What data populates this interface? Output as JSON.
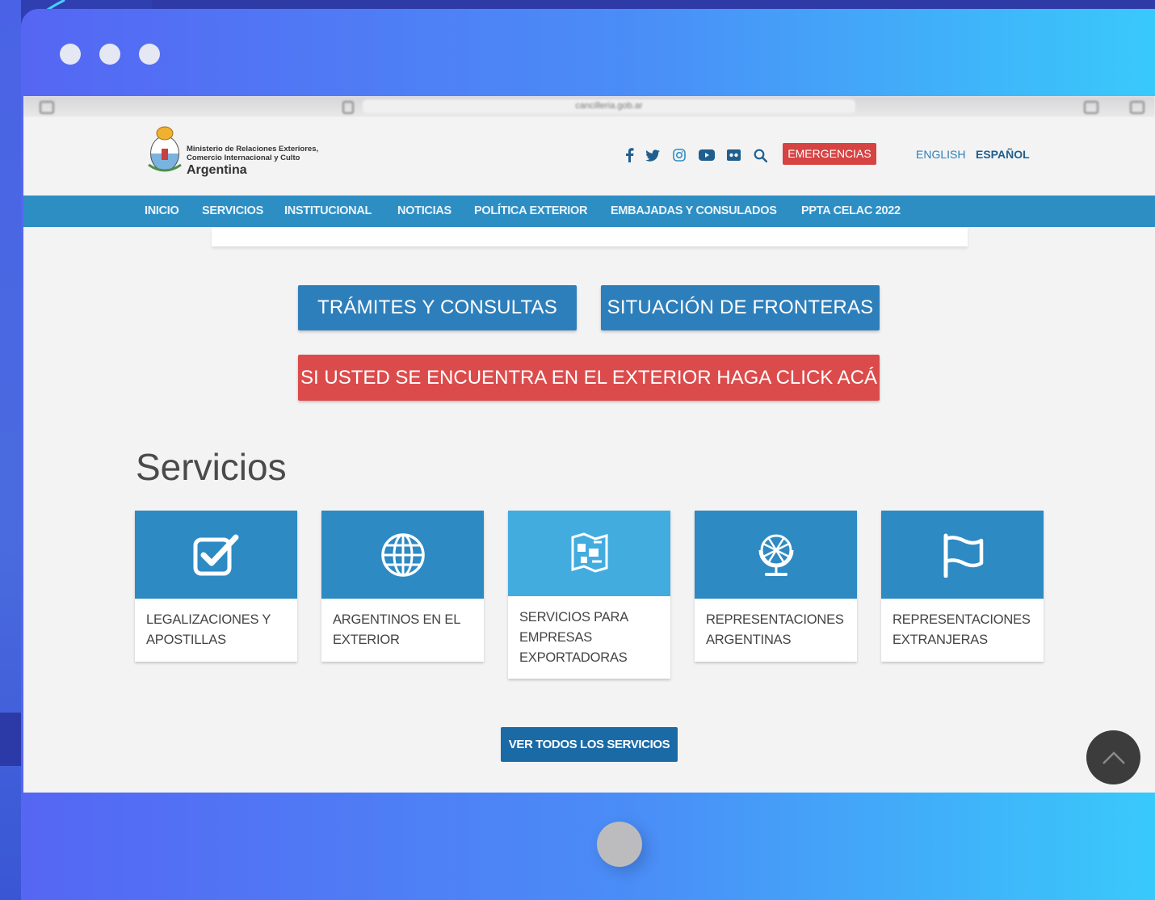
{
  "browser": {
    "url": "cancilleria.gob.ar"
  },
  "header": {
    "logo_line1": "Ministerio de Relaciones Exteriores,",
    "logo_line2": "Comercio Internacional y Culto",
    "logo_line3": "Argentina",
    "emergency_label": "EMERGENCIAS",
    "lang_english": "ENGLISH",
    "lang_spanish": "ESPAÑOL",
    "social_icons": [
      "facebook-icon",
      "twitter-icon",
      "instagram-icon",
      "youtube-icon",
      "flickr-icon",
      "search-icon"
    ]
  },
  "nav": {
    "items": [
      "INICIO",
      "SERVICIOS",
      "INSTITUCIONAL",
      "NOTICIAS",
      "POLÍTICA EXTERIOR",
      "EMBAJADAS Y CONSULADOS",
      "PPTA CELAC 2022"
    ]
  },
  "actions": {
    "tramites": "TRÁMITES Y CONSULTAS",
    "fronteras": "SITUACIÓN DE FRONTERAS",
    "exterior": "SI USTED SE ENCUENTRA EN EL EXTERIOR HAGA CLICK ACÁ"
  },
  "servicios": {
    "title": "Servicios",
    "cards": [
      {
        "label": "LEGALIZACIONES Y APOSTILLAS",
        "icon": "checkbox-icon"
      },
      {
        "label": "ARGENTINOS EN EL EXTERIOR",
        "icon": "globe-icon"
      },
      {
        "label": "SERVICIOS PARA EMPRESAS EXPORTADORAS",
        "icon": "map-icon"
      },
      {
        "label": "REPRESENTACIONES ARGENTINAS",
        "icon": "desk-globe-icon"
      },
      {
        "label": "REPRESENTACIONES EXTRANJERAS",
        "icon": "flag-icon"
      }
    ],
    "ver_todos": "VER TODOS LOS SERVICIOS"
  },
  "colors": {
    "nav_blue": "#2d8ec4",
    "button_blue": "#2d7fbb",
    "alert_red": "#dc4b4b",
    "dark_blue": "#1a6aa6"
  }
}
